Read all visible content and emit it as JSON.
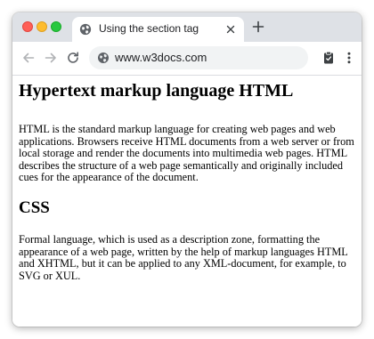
{
  "browser": {
    "tab": {
      "title": "Using the section tag",
      "favicon": "globe-icon"
    },
    "address_bar": {
      "url": "www.w3docs.com"
    },
    "icons": {
      "back": "arrow-left-icon",
      "forward": "arrow-right-icon",
      "reload": "reload-icon",
      "close_tab": "close-icon",
      "new_tab": "plus-icon",
      "security": "lock-icon",
      "clipboard": "clipboard-icon",
      "menu": "kebab-menu-icon"
    },
    "colors": {
      "tabstrip": "#dee1e6",
      "close_dot": "#ff5f57",
      "minimize_dot": "#febc2e",
      "maximize_dot": "#28c840"
    }
  },
  "page": {
    "heading1": "Hypertext markup language HTML",
    "paragraph1": "HTML is the standard markup language for creating web pages and web applications. Browsers receive HTML documents from a web server or from local storage and render the documents into multimedia web pages. HTML describes the structure of a web page semantically and originally included cues for the appearance of the document.",
    "heading2": "CSS",
    "paragraph2": "Formal language, which is used as a description zone, formatting the appearance of a web page, written by the help of markup languages HTML and XHTML, but it can be applied to any XML-document, for example, to SVG or XUL."
  }
}
